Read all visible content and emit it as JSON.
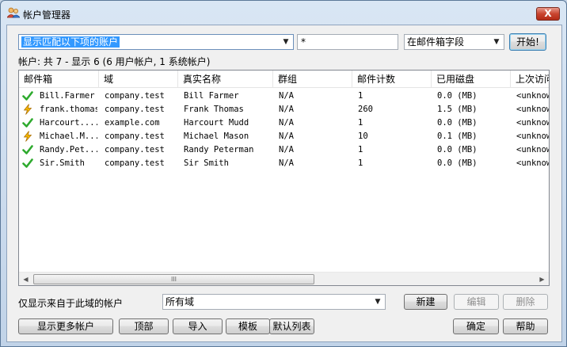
{
  "window": {
    "title": "帐户管理器",
    "close_label": "X"
  },
  "filter": {
    "mode_value": "显示匹配以下项的账户",
    "pattern_value": "*",
    "field_value": "在邮件箱字段",
    "start_label": "开始!"
  },
  "summary": "帐户: 共 7 - 显示 6 (6 用户帐户, 1 系统帐户)",
  "table": {
    "columns": [
      "邮件箱",
      "域",
      "真实名称",
      "群组",
      "邮件计数",
      "已用磁盘",
      "上次访问"
    ],
    "rows": [
      {
        "icon": "check-icon",
        "mailbox": "Bill.Farmer",
        "domain": "company.test",
        "realname": "Bill Farmer",
        "group": "N/A",
        "count": "1",
        "disk": "0.0 (MB)",
        "last": "<unknown>"
      },
      {
        "icon": "lightning-icon",
        "mailbox": "frank.thomas",
        "domain": "company.test",
        "realname": "Frank Thomas",
        "group": "N/A",
        "count": "260",
        "disk": "1.5 (MB)",
        "last": "<unknown>"
      },
      {
        "icon": "check-icon",
        "mailbox": "Harcourt....",
        "domain": "example.com",
        "realname": "Harcourt Mudd",
        "group": "N/A",
        "count": "1",
        "disk": "0.0 (MB)",
        "last": "<unknown>"
      },
      {
        "icon": "lightning-icon",
        "mailbox": "Michael.M...",
        "domain": "company.test",
        "realname": "Michael Mason",
        "group": "N/A",
        "count": "10",
        "disk": "0.1 (MB)",
        "last": "<unknown>"
      },
      {
        "icon": "check-icon",
        "mailbox": "Randy.Pet...",
        "domain": "company.test",
        "realname": "Randy Peterman",
        "group": "N/A",
        "count": "1",
        "disk": "0.0 (MB)",
        "last": "<unknown>"
      },
      {
        "icon": "check-icon",
        "mailbox": "Sir.Smith",
        "domain": "company.test",
        "realname": "Sir Smith",
        "group": "N/A",
        "count": "1",
        "disk": "0.0 (MB)",
        "last": "<unknown>"
      }
    ]
  },
  "domain_filter": {
    "label": "仅显示来自于此域的帐户",
    "value": "所有域"
  },
  "actions": {
    "new_label": "新建",
    "edit_label": "编辑",
    "delete_label": "删除"
  },
  "bottom": {
    "more_label": "显示更多帐户",
    "top_label": "顶部",
    "import_label": "导入",
    "template_label": "模板",
    "default_cols_label": "默认列表",
    "ok_label": "确定",
    "help_label": "帮助"
  },
  "scrollbar": {
    "grip": "III"
  },
  "colors": {
    "check": "#2eaa2e",
    "lightning": "#f5b800",
    "selection": "#3399ff"
  }
}
